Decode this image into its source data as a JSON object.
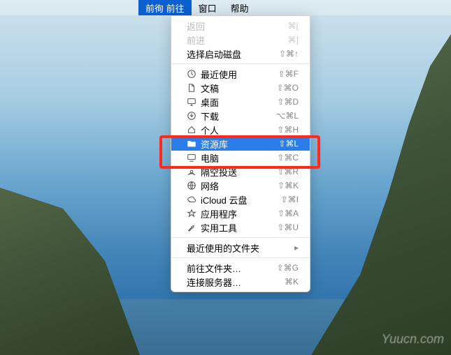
{
  "menubar": {
    "items": [
      {
        "label": "前徇 前往",
        "active": true
      },
      {
        "label": "窗口",
        "active": false
      },
      {
        "label": "帮助",
        "active": false
      }
    ]
  },
  "dropdown": {
    "section1": [
      {
        "label": "返回",
        "shortcut": "⌘[",
        "disabled": true
      },
      {
        "label": "前进",
        "shortcut": "⌘]",
        "disabled": true
      },
      {
        "label": "选择启动磁盘",
        "shortcut": "⇧⌘↑",
        "disabled": false
      }
    ],
    "section2": [
      {
        "icon": "clock-icon",
        "label": "最近使用",
        "shortcut": "⇧⌘F"
      },
      {
        "icon": "document-icon",
        "label": "文稿",
        "shortcut": "⇧⌘O"
      },
      {
        "icon": "desktop-icon",
        "label": "桌面",
        "shortcut": "⇧⌘D"
      },
      {
        "icon": "download-icon",
        "label": "下载",
        "shortcut": "⌥⌘L"
      },
      {
        "icon": "home-icon",
        "label": "个人",
        "shortcut": "⇧⌘H"
      },
      {
        "icon": "folder-icon",
        "label": "资源库",
        "shortcut": "⇧⌘L",
        "selected": true
      },
      {
        "icon": "computer-icon",
        "label": "电脑",
        "shortcut": "⇧⌘C"
      },
      {
        "icon": "airdrop-icon",
        "label": "隔空投送",
        "shortcut": "⇧⌘R"
      },
      {
        "icon": "network-icon",
        "label": "网络",
        "shortcut": "⇧⌘K"
      },
      {
        "icon": "cloud-icon",
        "label": "iCloud 云盘",
        "shortcut": "⇧⌘I"
      },
      {
        "icon": "apps-icon",
        "label": "应用程序",
        "shortcut": "⇧⌘A"
      },
      {
        "icon": "tools-icon",
        "label": "实用工具",
        "shortcut": "⇧⌘U"
      }
    ],
    "section3": [
      {
        "label": "最近使用的文件夹",
        "submenu": true
      }
    ],
    "section4": [
      {
        "label": "前往文件夹…",
        "shortcut": "⇧⌘G"
      },
      {
        "label": "连接服务器…",
        "shortcut": "⌘K"
      }
    ]
  },
  "watermark": "Yuucn.com"
}
